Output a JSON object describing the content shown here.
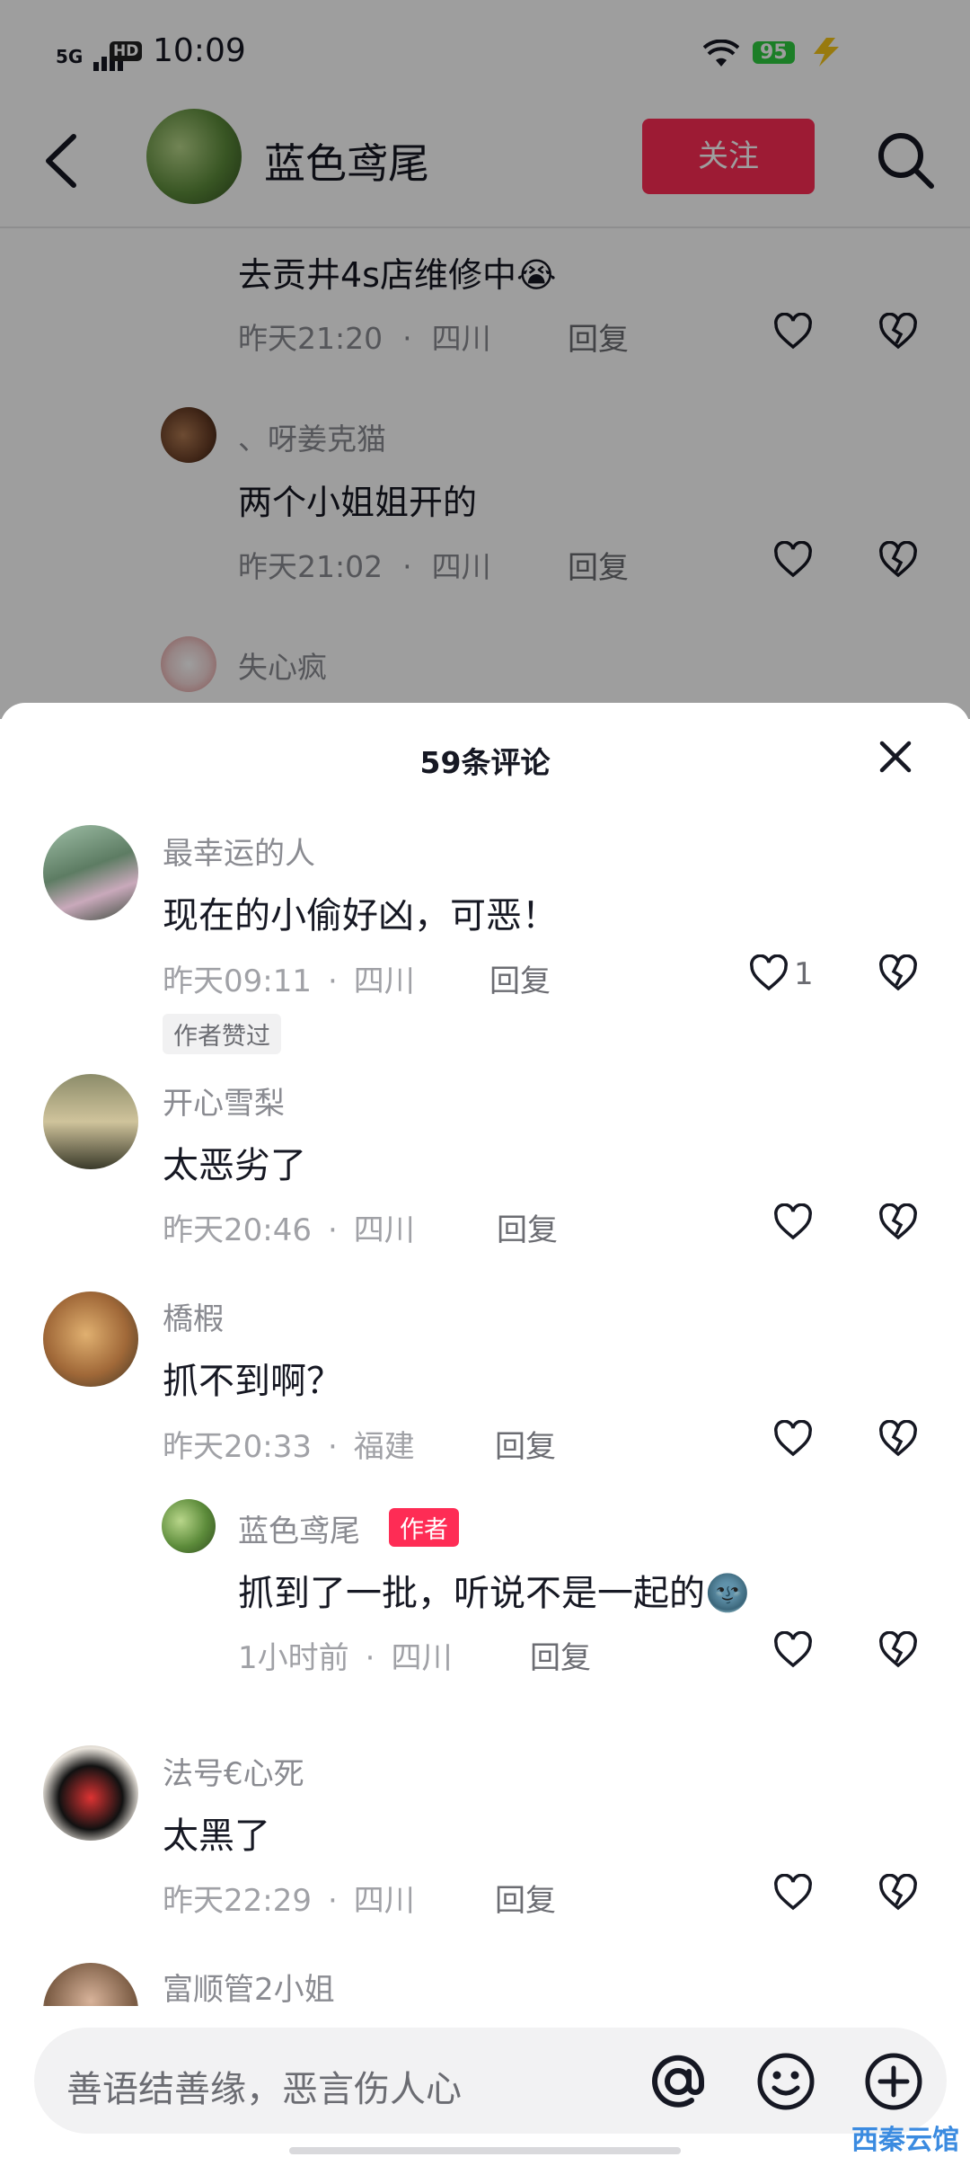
{
  "status_bar": {
    "network": "5G",
    "hd": "HD",
    "time": "10:09",
    "battery": "95"
  },
  "header": {
    "username": "蓝色鸢尾",
    "follow_label": "关注"
  },
  "background_comments": [
    {
      "text": "去贡井4s店维修中😭",
      "time": "昨天21:20",
      "location": "四川",
      "reply_label": "回复"
    },
    {
      "name": "、呀姜克猫",
      "text": "两个小姐姐开的",
      "time": "昨天21:02",
      "location": "四川",
      "reply_label": "回复"
    },
    {
      "name": "失心疯"
    }
  ],
  "sheet": {
    "title": "59条评论",
    "comments": [
      {
        "name": "最幸运的人",
        "text": "现在的小偷好凶，可恶！",
        "time": "昨天09:11",
        "location": "四川",
        "reply_label": "回复",
        "like_count": "1",
        "badge": "作者赞过"
      },
      {
        "name": "开心雪梨",
        "text": "太恶劣了",
        "time": "昨天20:46",
        "location": "四川",
        "reply_label": "回复"
      },
      {
        "name": "橋椵",
        "text": "抓不到啊？",
        "time": "昨天20:33",
        "location": "福建",
        "reply_label": "回复"
      },
      {
        "name": "蓝色鸢尾",
        "author_badge": "作者",
        "text": "抓到了一批，听说不是一起的🌚",
        "time": "1小时前",
        "location": "四川",
        "reply_label": "回复"
      },
      {
        "name": "法号€心死",
        "text": "太黑了",
        "time": "昨天22:29",
        "location": "四川",
        "reply_label": "回复"
      },
      {
        "name": "富顺管2小姐"
      }
    ]
  },
  "input": {
    "placeholder": "善语结善缘，恶言伤人心"
  },
  "watermark": "西秦云馆",
  "colors": {
    "accent": "#fe2c55",
    "battery": "#2ecc40"
  }
}
